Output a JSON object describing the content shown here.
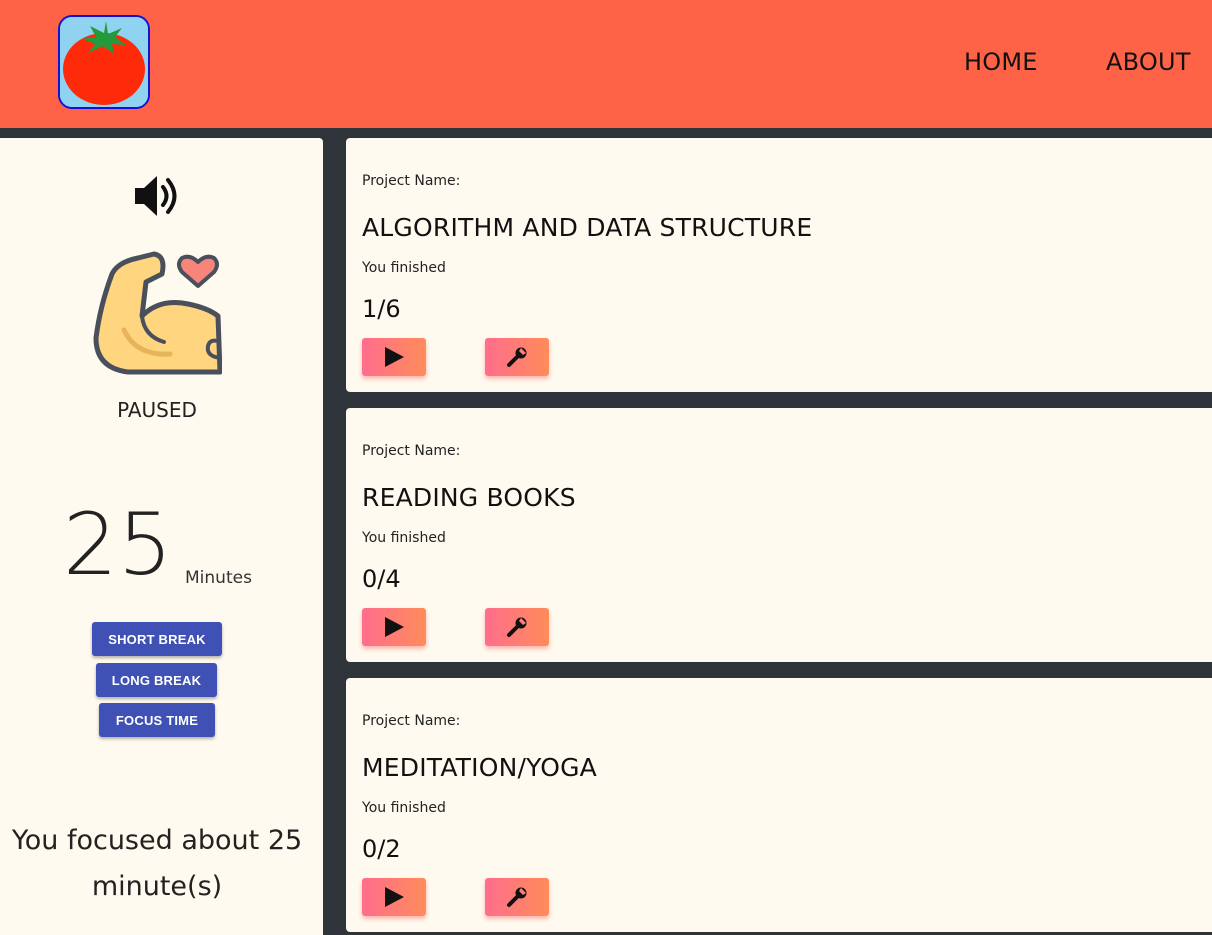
{
  "header": {
    "logo_icon": "tomato-icon",
    "nav": {
      "home": "HOME",
      "about": "ABOUT"
    },
    "colors": {
      "background": "#ff6347"
    }
  },
  "sidebar": {
    "sound_icon": "speaker-icon",
    "mood_icon": "flexed-arm-heart-icon",
    "status": "PAUSED",
    "minutes": "25",
    "minutes_label": "Minutes",
    "buttons": {
      "short_break": "SHORT BREAK",
      "long_break": "LONG BREAK",
      "focus_time": "FOCUS TIME"
    },
    "focused_text": "You focused about 25 minute(s)"
  },
  "projects": [
    {
      "label": "Project Name:",
      "name": "ALGORITHM AND DATA STRUCTURE",
      "finished_label": "You finished",
      "progress": "1/6",
      "play_icon": "play-icon",
      "settings_icon": "wrench-icon"
    },
    {
      "label": "Project Name:",
      "name": "READING BOOKS",
      "finished_label": "You finished",
      "progress": "0/4",
      "play_icon": "play-icon",
      "settings_icon": "wrench-icon"
    },
    {
      "label": "Project Name:",
      "name": "MEDITATION/YOGA",
      "finished_label": "You finished",
      "progress": "0/2",
      "play_icon": "play-icon",
      "settings_icon": "wrench-icon"
    }
  ],
  "colors": {
    "page_bg": "#2f333a",
    "panel_bg": "#fffaef",
    "primary_button": "#3f51b5"
  }
}
